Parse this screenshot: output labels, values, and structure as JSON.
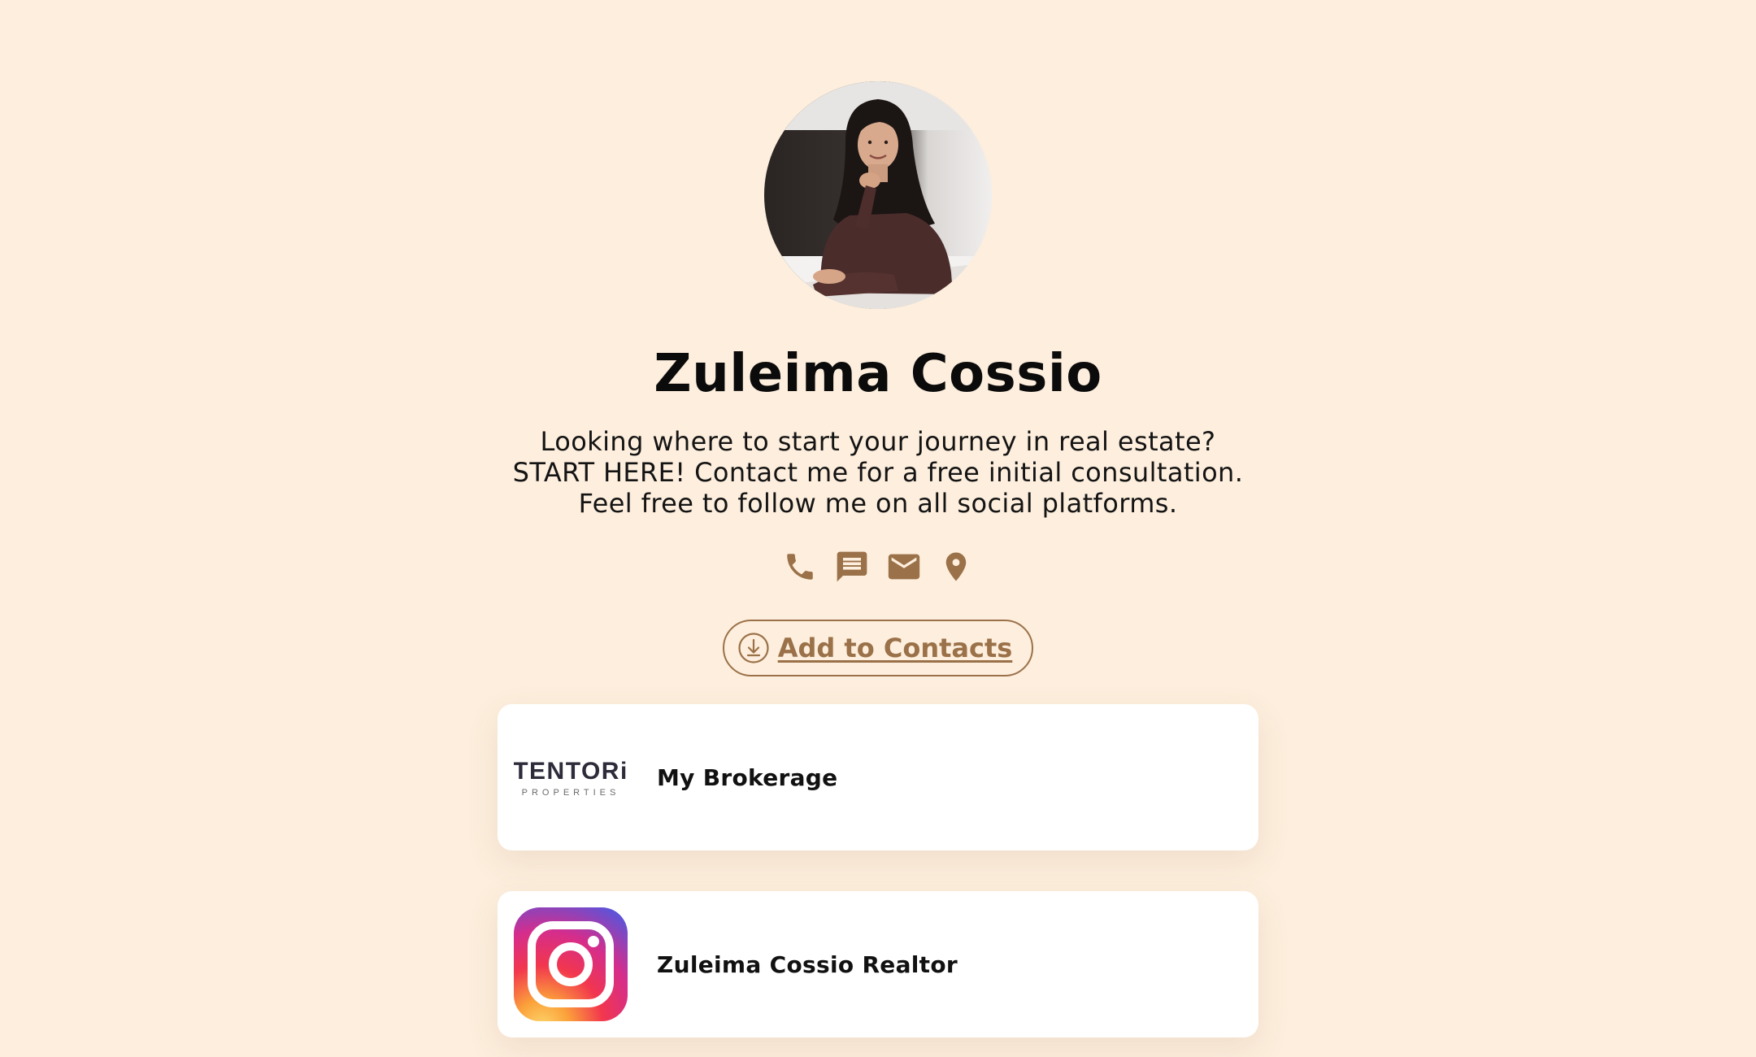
{
  "profile": {
    "name": "Zuleima Cossio",
    "bio": "Looking where to start your journey in real estate? START HERE! Contact me for a free initial consultation. Feel free to follow me on all social platforms.",
    "avatar_icon": "profile-photo"
  },
  "contact_icons": [
    "phone-icon",
    "message-icon",
    "email-icon",
    "location-pin-icon"
  ],
  "add_contacts": {
    "label": "Add to Contacts",
    "icon": "download-circle-icon"
  },
  "links": [
    {
      "title": "My Brokerage",
      "logo_text": "TENTORi",
      "logo_subtext": "PROPERTIES",
      "icon": "tentori-logo"
    },
    {
      "title": "Zuleima Cossio Realtor",
      "icon": "instagram-icon"
    }
  ],
  "colors": {
    "background": "#FDEEDD",
    "accent": "#9A7148",
    "card": "#FFFFFF",
    "text": "#111111"
  }
}
